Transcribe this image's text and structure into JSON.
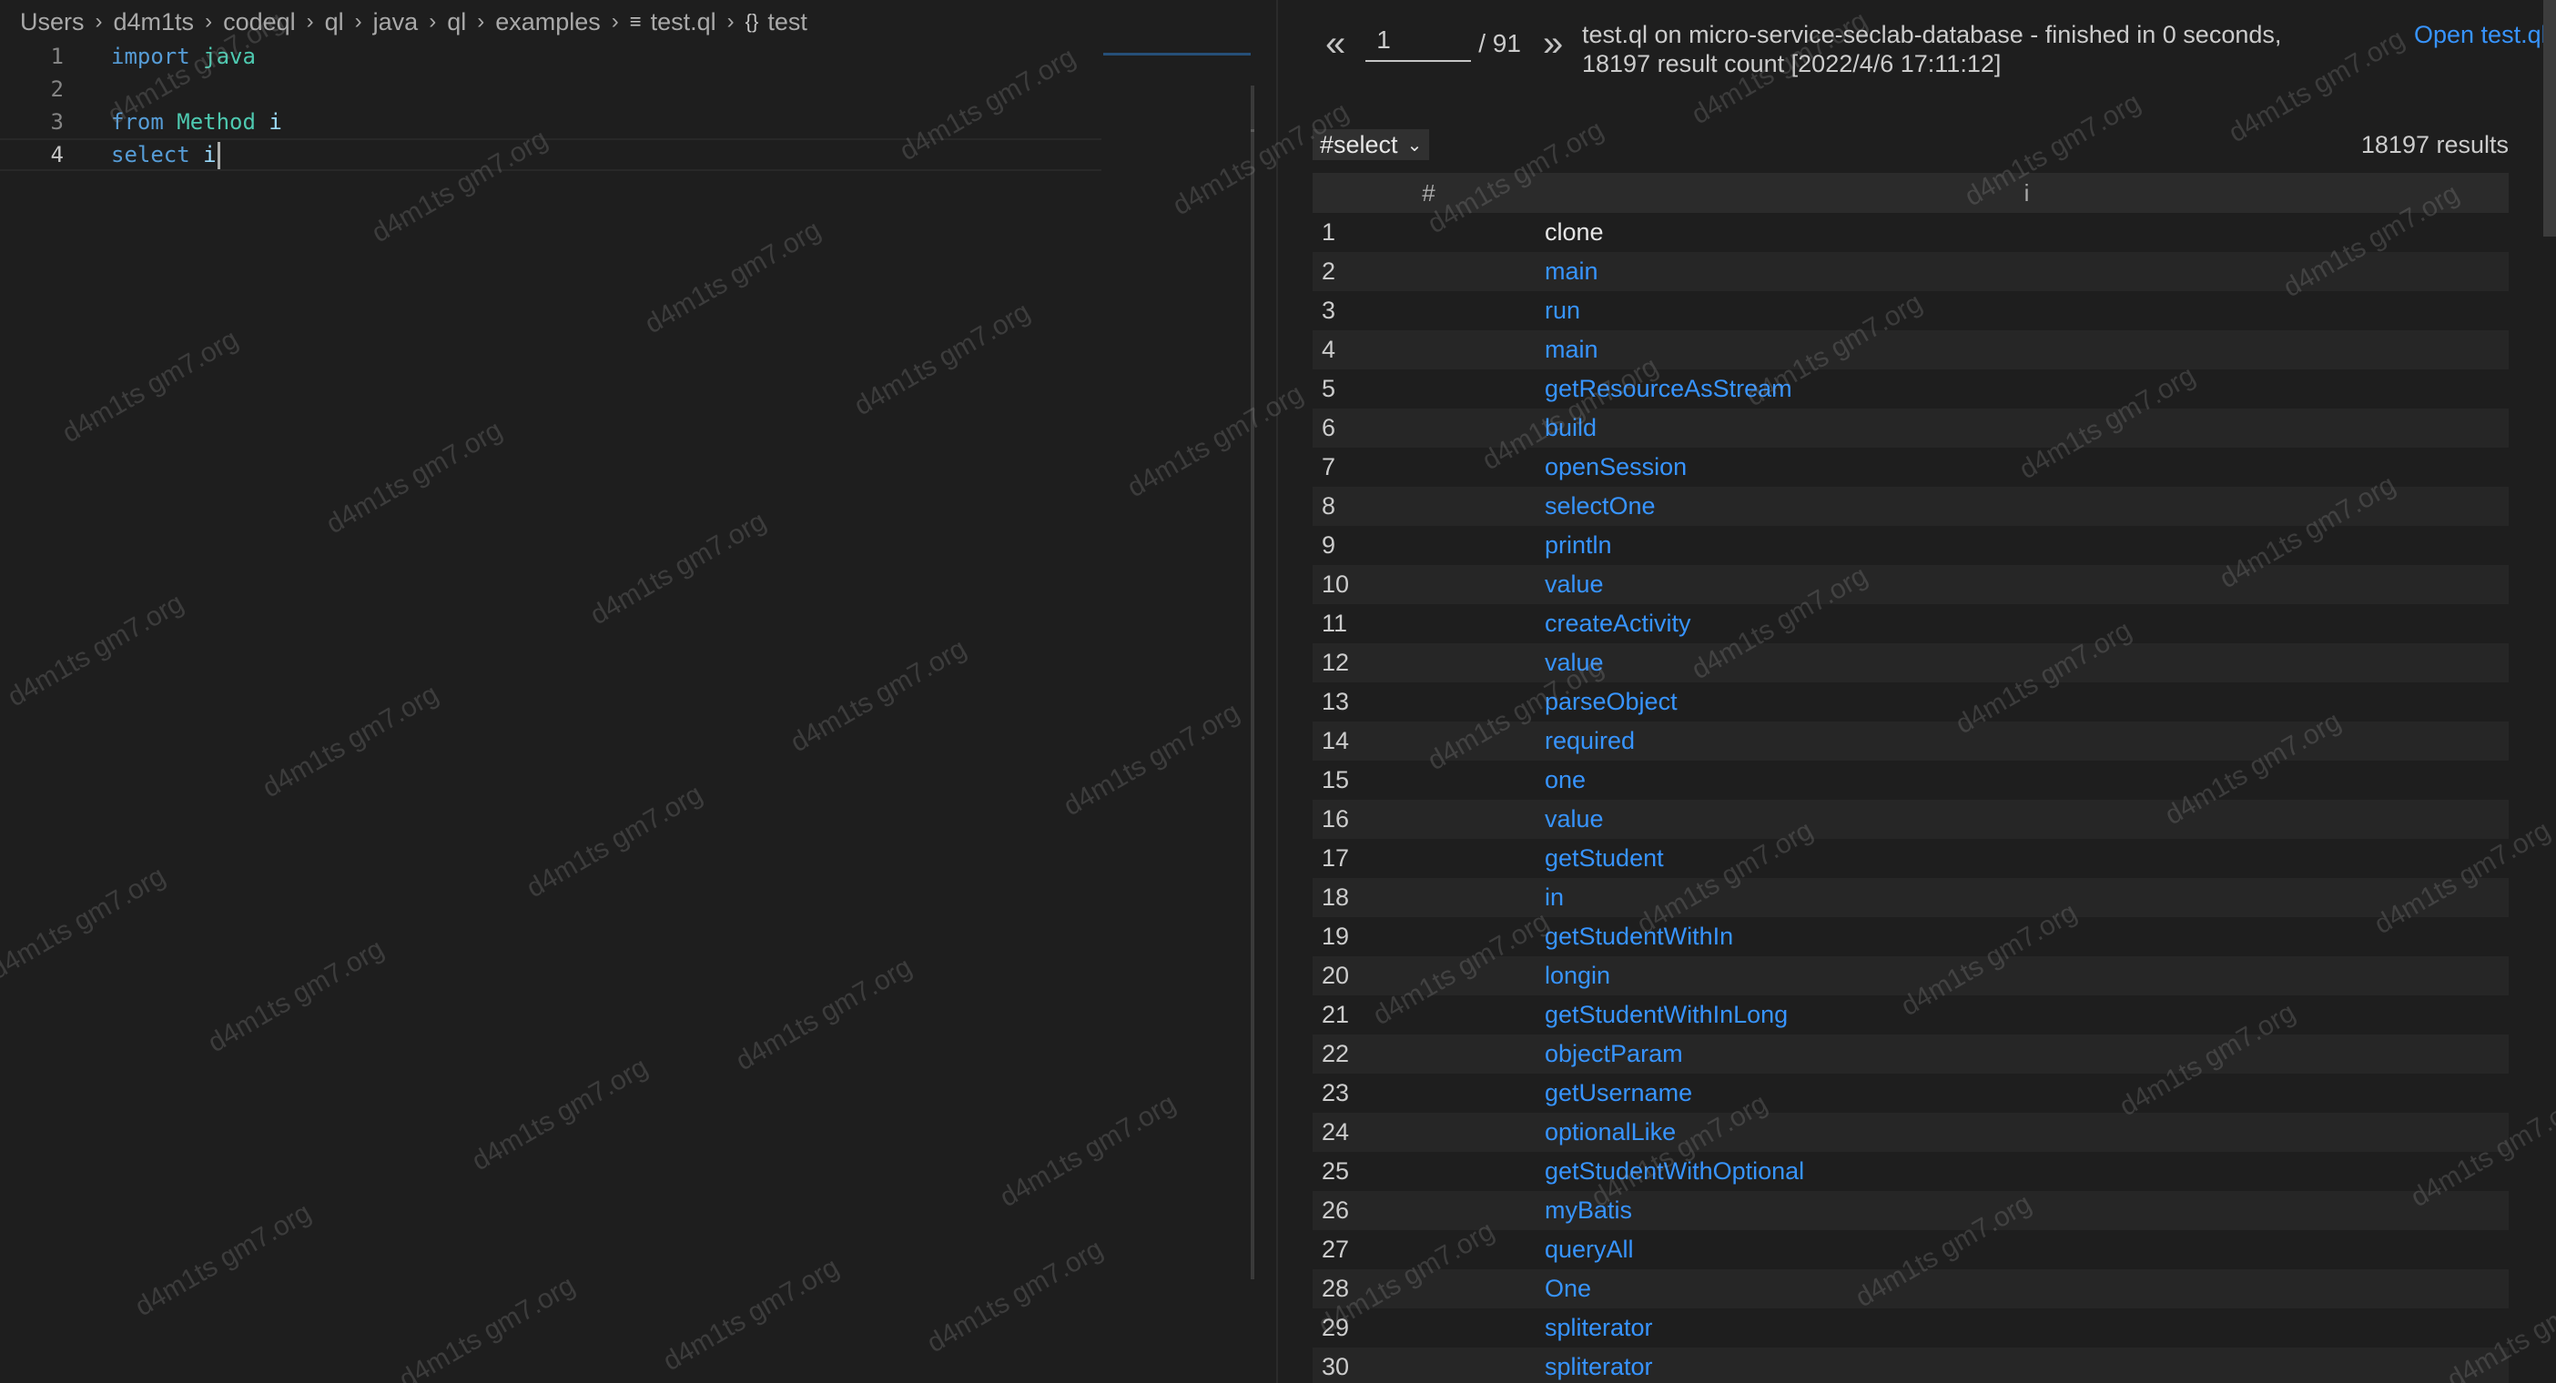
{
  "breadcrumb": {
    "segments": [
      "Users",
      "d4m1ts",
      "codeql",
      "ql",
      "java",
      "ql",
      "examples"
    ],
    "file": "test.ql",
    "symbol": "test",
    "file_icon": "lines-file-icon",
    "symbol_icon": "braces-icon"
  },
  "editor": {
    "lines": [
      {
        "num": "1",
        "tokens": [
          {
            "t": "import",
            "c": "kw"
          },
          {
            "t": " ",
            "c": ""
          },
          {
            "t": "java",
            "c": "ty"
          }
        ]
      },
      {
        "num": "2",
        "tokens": []
      },
      {
        "num": "3",
        "tokens": [
          {
            "t": "from",
            "c": "kw"
          },
          {
            "t": " ",
            "c": ""
          },
          {
            "t": "Method",
            "c": "ty"
          },
          {
            "t": " ",
            "c": ""
          },
          {
            "t": "i",
            "c": "id"
          }
        ]
      },
      {
        "num": "4",
        "tokens": [
          {
            "t": "select",
            "c": "kw"
          },
          {
            "t": " ",
            "c": ""
          },
          {
            "t": "i",
            "c": "id"
          }
        ],
        "current": true
      }
    ]
  },
  "results": {
    "prev_label": "«",
    "next_label": "»",
    "page_value": "1",
    "page_total": "/ 91",
    "query_info": "test.ql on micro-service-seclab-database - finished in 0 seconds, 18197 result count [2022/4/6 17:11:12]",
    "open_link": "Open test.ql",
    "select_value": "#select",
    "result_count": "18197 results",
    "columns": [
      "#",
      "i"
    ],
    "rows": [
      {
        "n": "1",
        "v": "clone",
        "link": false
      },
      {
        "n": "2",
        "v": "main",
        "link": true
      },
      {
        "n": "3",
        "v": "run",
        "link": true
      },
      {
        "n": "4",
        "v": "main",
        "link": true
      },
      {
        "n": "5",
        "v": "getResourceAsStream",
        "link": true
      },
      {
        "n": "6",
        "v": "build",
        "link": true
      },
      {
        "n": "7",
        "v": "openSession",
        "link": true
      },
      {
        "n": "8",
        "v": "selectOne",
        "link": true
      },
      {
        "n": "9",
        "v": "println",
        "link": true
      },
      {
        "n": "10",
        "v": "value",
        "link": true
      },
      {
        "n": "11",
        "v": "createActivity",
        "link": true
      },
      {
        "n": "12",
        "v": "value",
        "link": true
      },
      {
        "n": "13",
        "v": "parseObject",
        "link": true
      },
      {
        "n": "14",
        "v": "required",
        "link": true
      },
      {
        "n": "15",
        "v": "one",
        "link": true
      },
      {
        "n": "16",
        "v": "value",
        "link": true
      },
      {
        "n": "17",
        "v": "getStudent",
        "link": true
      },
      {
        "n": "18",
        "v": "in",
        "link": true
      },
      {
        "n": "19",
        "v": "getStudentWithIn",
        "link": true
      },
      {
        "n": "20",
        "v": "longin",
        "link": true
      },
      {
        "n": "21",
        "v": "getStudentWithInLong",
        "link": true
      },
      {
        "n": "22",
        "v": "objectParam",
        "link": true
      },
      {
        "n": "23",
        "v": "getUsername",
        "link": true
      },
      {
        "n": "24",
        "v": "optionalLike",
        "link": true
      },
      {
        "n": "25",
        "v": "getStudentWithOptional",
        "link": true
      },
      {
        "n": "26",
        "v": "myBatis",
        "link": true
      },
      {
        "n": "27",
        "v": "queryAll",
        "link": true
      },
      {
        "n": "28",
        "v": "One",
        "link": true
      },
      {
        "n": "29",
        "v": "spliterator",
        "link": true
      },
      {
        "n": "30",
        "v": "spliterator",
        "link": true
      }
    ]
  },
  "watermark": "d4m1ts gm7.org",
  "colors": {
    "accent_link": "#3794ff",
    "keyword": "#569cd6",
    "type": "#4ec9b0",
    "identifier": "#9cdcfe",
    "background": "#1e1e1e"
  }
}
